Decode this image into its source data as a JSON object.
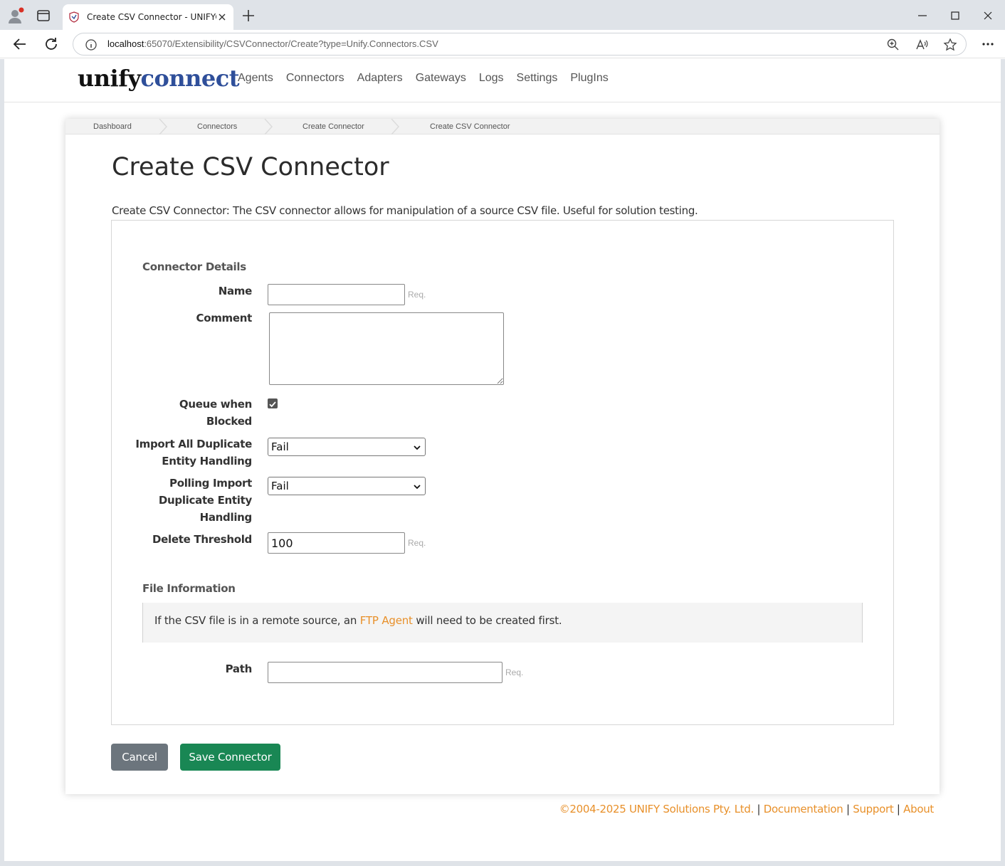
{
  "browser": {
    "tab_title": "Create CSV Connector - UNIFYConnect",
    "url_host": "localhost",
    "url_rest": ":65070/Extensibility/CSVConnector/Create?type=Unify.Connectors.CSV"
  },
  "header": {
    "logo_part1": "unify",
    "logo_part2": "connect",
    "nav": [
      "Agents",
      "Connectors",
      "Adapters",
      "Gateways",
      "Logs",
      "Settings",
      "PlugIns"
    ]
  },
  "breadcrumb": [
    "Dashboard",
    "Connectors",
    "Create Connector",
    "Create CSV Connector"
  ],
  "page": {
    "title": "Create CSV Connector",
    "description": "Create CSV Connector: The CSV connector allows for manipulation of a source CSV file. Useful for solution testing."
  },
  "form": {
    "section_details": "Connector Details",
    "name_label": "Name",
    "name_value": "",
    "req": "Req.",
    "comment_label": "Comment",
    "queue_label": "Queue when Blocked",
    "queue_checked": true,
    "import_dup_label": "Import All Duplicate Entity Handling",
    "import_dup_value": "Fail",
    "polling_dup_label": "Polling Import Duplicate Entity Handling",
    "polling_dup_value": "Fail",
    "delete_threshold_label": "Delete Threshold",
    "delete_threshold_value": "100",
    "section_file": "File Information",
    "info_text_before": "If the CSV file is in a remote source, an ",
    "info_link": "FTP Agent",
    "info_text_after": " will need to be created first.",
    "path_label": "Path",
    "path_value": ""
  },
  "buttons": {
    "cancel": "Cancel",
    "save": "Save Connector"
  },
  "footer": {
    "copyright": "©2004-2025 UNIFY Solutions Pty. Ltd.",
    "sep": "|",
    "documentation": "Documentation",
    "support": "Support",
    "about": "About"
  },
  "colors": {
    "accent_link": "#e8902a",
    "logo_blue": "#2f4f9a",
    "save_green": "#198754",
    "cancel_gray": "#6c757d"
  }
}
